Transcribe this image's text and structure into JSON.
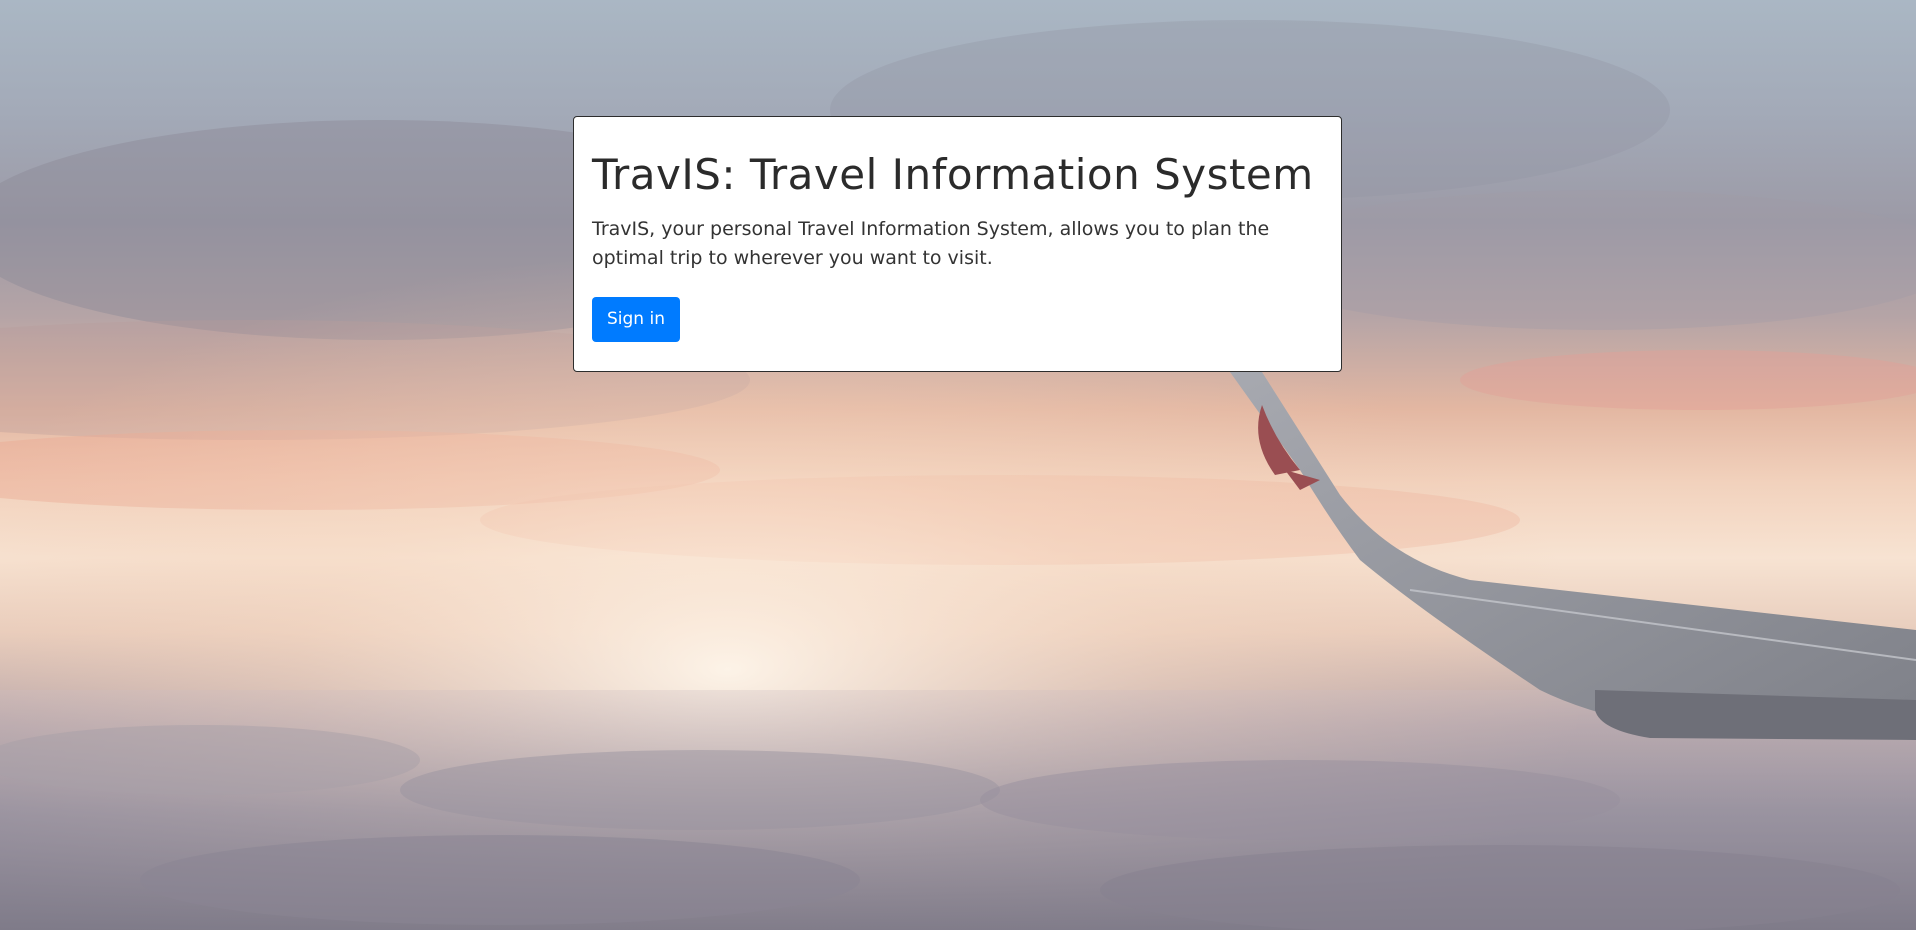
{
  "hero": {
    "title": "TravIS: Travel Information System",
    "description": "TravIS, your personal Travel Information System, allows you to plan the optimal trip to wherever you want to visit.",
    "sign_in_label": "Sign in"
  },
  "colors": {
    "button": "#007bff",
    "card_background": "#ffffff",
    "text": "#2f2f2f"
  },
  "background": {
    "description_icon": "airplane-wing-over-clouds-image"
  }
}
